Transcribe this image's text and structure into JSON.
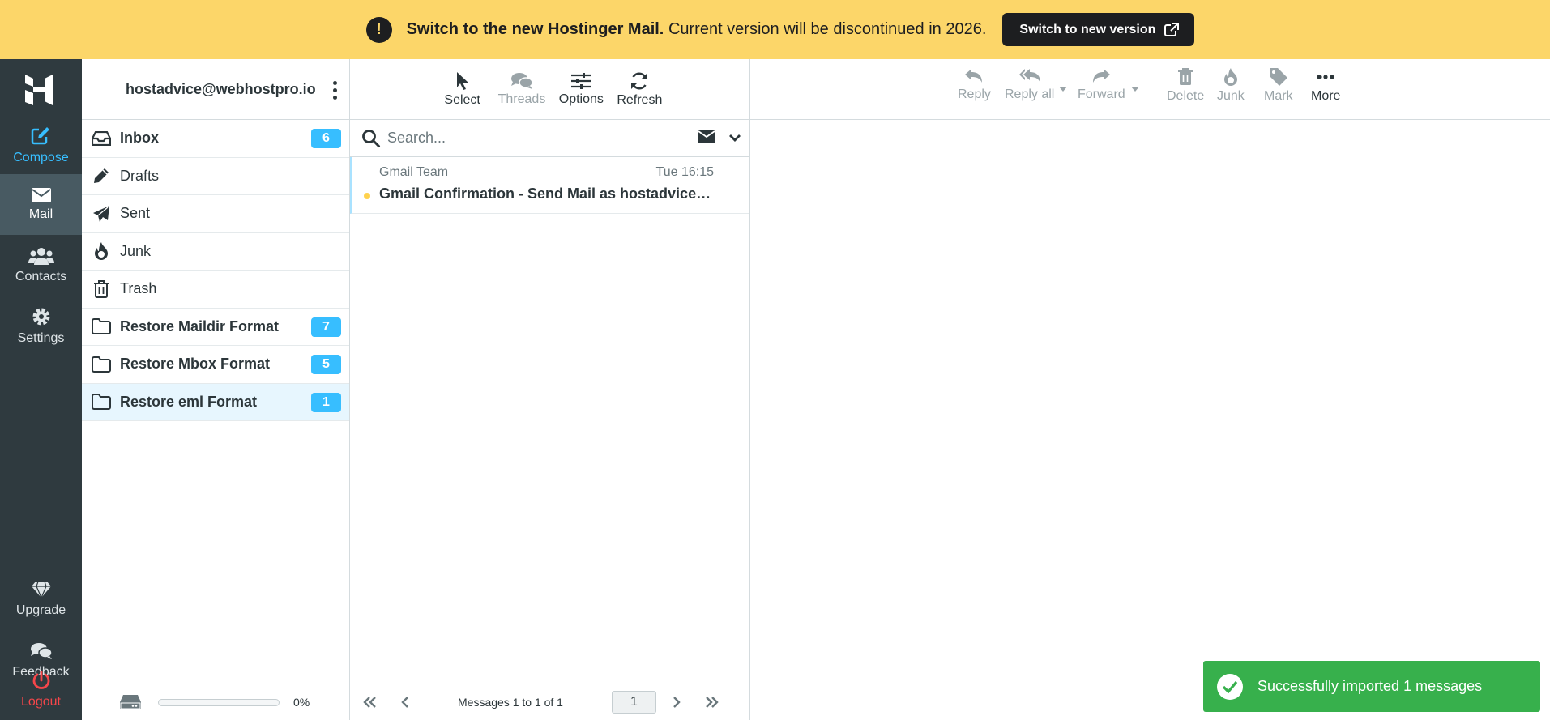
{
  "banner": {
    "title": "Switch to the new Hostinger Mail.",
    "message": "Current version will be discontinued in 2026.",
    "button_label": "Switch to new version",
    "alert_symbol": "!"
  },
  "nav": {
    "compose": "Compose",
    "mail": "Mail",
    "contacts": "Contacts",
    "settings": "Settings",
    "upgrade": "Upgrade",
    "feedback": "Feedback",
    "logout": "Logout"
  },
  "account": {
    "email": "hostadvice@webhostpro.io"
  },
  "folders": [
    {
      "name": "Inbox",
      "icon": "inbox-icon",
      "count": "6",
      "bold": true
    },
    {
      "name": "Drafts",
      "icon": "pencil-icon",
      "count": "",
      "bold": false
    },
    {
      "name": "Sent",
      "icon": "paper-plane-icon",
      "count": "",
      "bold": false
    },
    {
      "name": "Junk",
      "icon": "fire-icon",
      "count": "",
      "bold": false
    },
    {
      "name": "Trash",
      "icon": "trash-icon",
      "count": "",
      "bold": false
    },
    {
      "name": "Restore Maildir Format",
      "icon": "folder-icon",
      "count": "7",
      "bold": true
    },
    {
      "name": "Restore Mbox Format",
      "icon": "folder-icon",
      "count": "5",
      "bold": true
    },
    {
      "name": "Restore eml Format",
      "icon": "folder-icon",
      "count": "1",
      "bold": true,
      "selected": true
    }
  ],
  "quota": {
    "percent_text": "0%",
    "fraction": 0
  },
  "list_toolbar": {
    "select": "Select",
    "threads": "Threads",
    "options": "Options",
    "refresh": "Refresh"
  },
  "search": {
    "placeholder": "Search..."
  },
  "messages": [
    {
      "from": "Gmail Team",
      "date": "Tue 16:15",
      "subject": "Gmail Confirmation - Send Mail as hostadvice@webhostpro.io",
      "unread": true
    }
  ],
  "pagination": {
    "count_text": "Messages 1 to 1 of 1",
    "page": "1"
  },
  "reader_toolbar": {
    "reply": "Reply",
    "reply_all": "Reply all",
    "forward": "Forward",
    "delete": "Delete",
    "junk": "Junk",
    "mark": "Mark",
    "more": "More"
  },
  "toast": {
    "message": "Successfully imported 1 messages"
  },
  "colors": {
    "banner": "#fcd669",
    "accent": "#37beff",
    "nav_bg": "#2f3a3f",
    "success": "#37b04c",
    "logout": "#f5464a"
  }
}
